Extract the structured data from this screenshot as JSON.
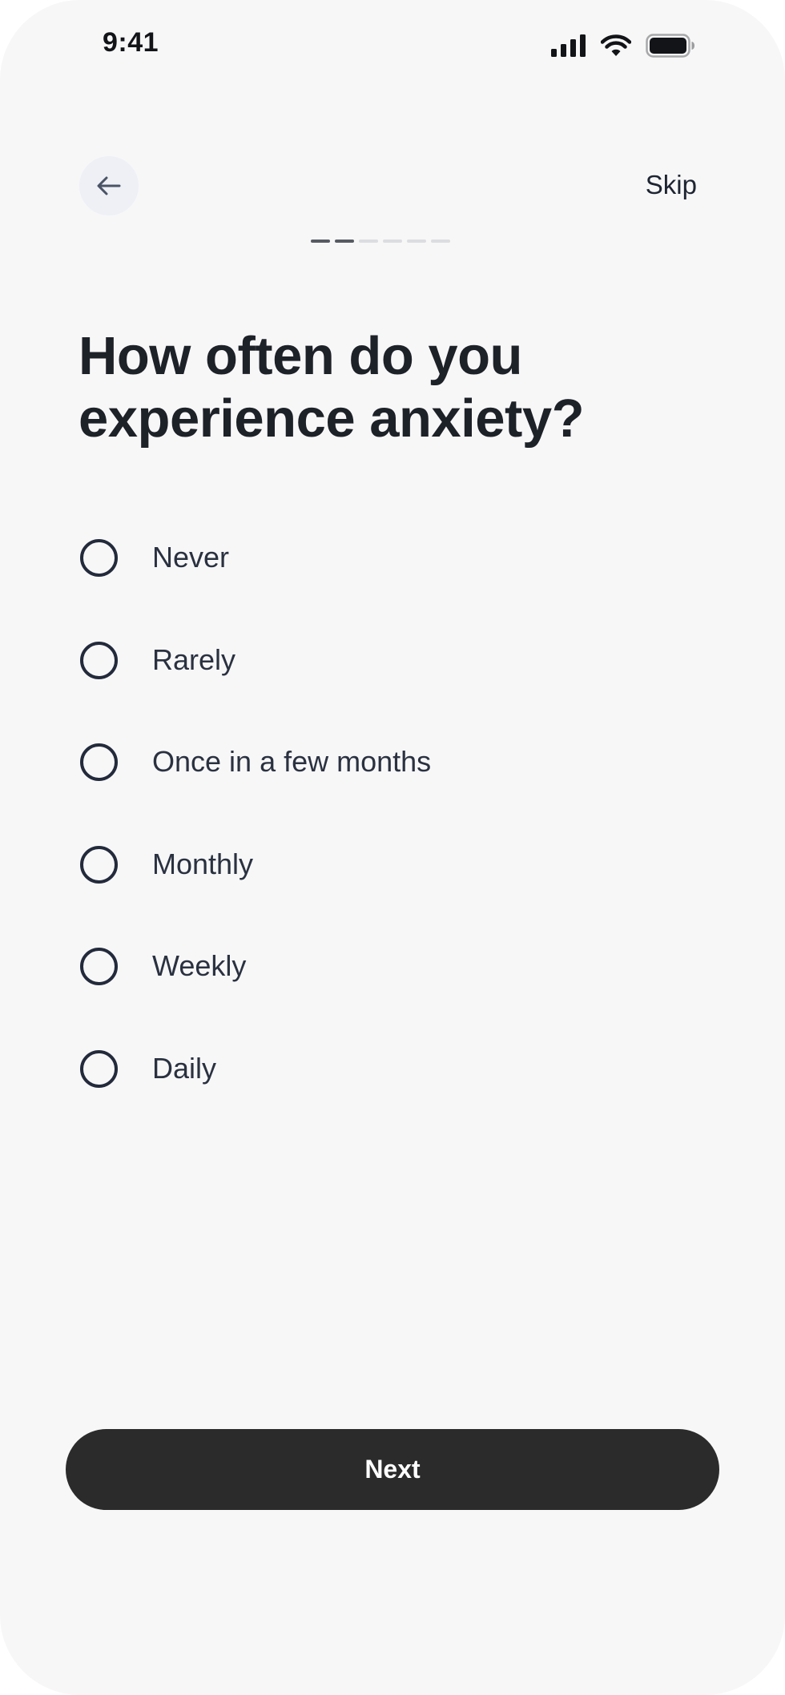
{
  "status_bar": {
    "time": "9:41"
  },
  "header": {
    "back_icon": "arrow-left-icon",
    "skip_label": "Skip",
    "progress": {
      "current_step": 2,
      "total_steps": 6
    }
  },
  "question": {
    "title": "How often do you experience anxiety?"
  },
  "options": [
    {
      "label": "Never",
      "selected": false
    },
    {
      "label": "Rarely",
      "selected": false
    },
    {
      "label": "Once in a few months",
      "selected": false
    },
    {
      "label": "Monthly",
      "selected": false
    },
    {
      "label": "Weekly",
      "selected": false
    },
    {
      "label": "Daily",
      "selected": false
    }
  ],
  "footer": {
    "next_label": "Next"
  },
  "colors": {
    "background": "#f7f7f8",
    "text_primary": "#1d2128",
    "button_dark": "#2b2b2b",
    "back_button_bg": "#eef0f6"
  }
}
